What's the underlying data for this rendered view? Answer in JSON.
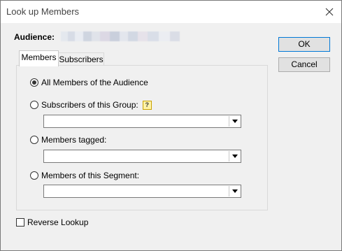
{
  "window": {
    "title": "Look up Members"
  },
  "audience": {
    "label": "Audience:"
  },
  "buttons": {
    "ok": "OK",
    "cancel": "Cancel"
  },
  "tabs": [
    {
      "label": "Members",
      "selected": true
    },
    {
      "label": "Subscribers",
      "selected": false
    }
  ],
  "options": [
    {
      "label": "All Members of the Audience",
      "checked": true
    },
    {
      "label": "Subscribers of this Group:",
      "checked": false,
      "help": "?"
    },
    {
      "label": "Members tagged:",
      "checked": false
    },
    {
      "label": "Members of this Segment:",
      "checked": false
    }
  ],
  "dropdowns": {
    "group": "",
    "tag": "",
    "segment": ""
  },
  "reverse_lookup": {
    "label": "Reverse Lookup",
    "checked": false
  }
}
